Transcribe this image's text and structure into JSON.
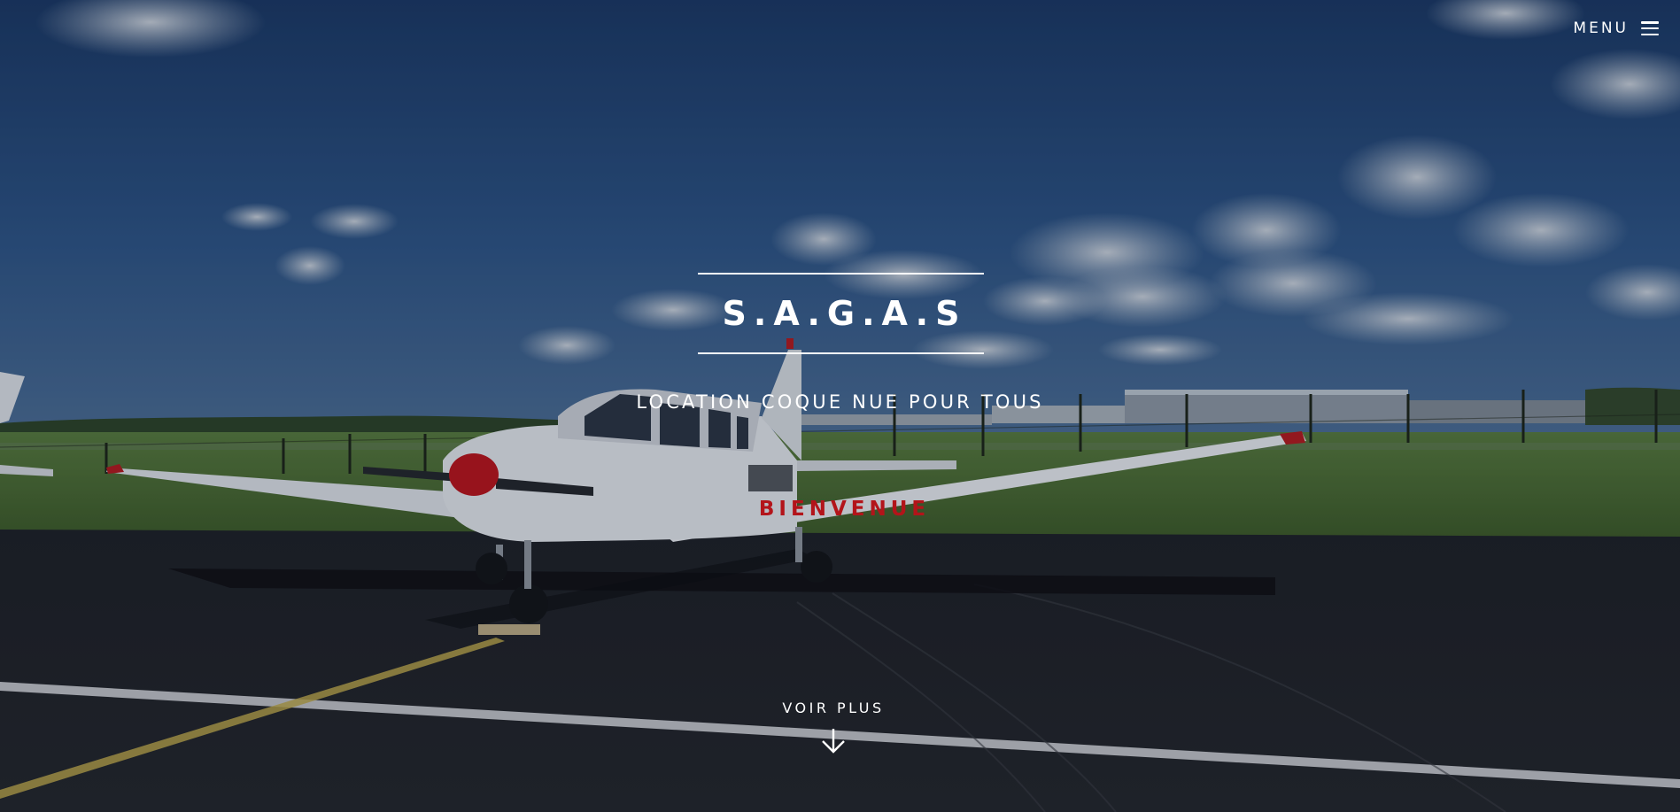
{
  "header": {
    "menu_label": "MENU",
    "menu_icon": "hamburger-icon"
  },
  "hero": {
    "title": "S.A.G.A.S",
    "tagline": "LOCATION COQUE NUE POUR TOUS",
    "welcome": "BIENVENUE",
    "scroll_label": "VOIR PLUS",
    "scroll_icon": "arrow-down-icon",
    "background_scene": "light-aircraft-on-tarmac"
  },
  "colors": {
    "text": "#ffffff",
    "accent": "#b3141a",
    "sky": "#1f3f6e",
    "tarmac": "#1a1c21"
  }
}
